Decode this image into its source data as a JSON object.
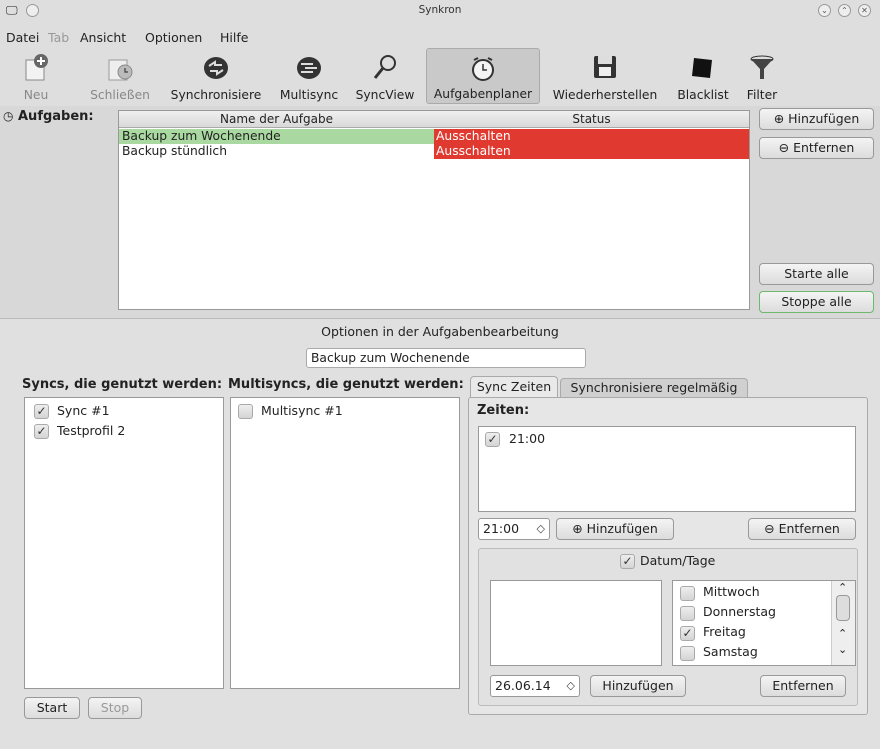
{
  "window": {
    "title": "Synkron"
  },
  "menu": [
    "Datei",
    "Tab",
    "Ansicht",
    "Optionen",
    "Hilfe"
  ],
  "toolbar": {
    "neu": "Neu",
    "schliessen": "Schließen",
    "synchronisiere": "Synchronisiere",
    "multisync": "Multisync",
    "syncview": "SyncView",
    "aufgabenplaner": "Aufgabenplaner",
    "wiederherstellen": "Wiederherstellen",
    "blacklist": "Blacklist",
    "filter": "Filter"
  },
  "tasks": {
    "label": "Aufgaben:",
    "col_name": "Name der Aufgabe",
    "col_status": "Status",
    "rows": [
      {
        "name": "Backup zum Wochenende",
        "status": "Ausschalten"
      },
      {
        "name": "Backup stündlich",
        "status": "Ausschalten"
      }
    ],
    "add": "Hinzufügen",
    "remove": "Entfernen",
    "start_all": "Starte alle",
    "stop_all": "Stoppe alle"
  },
  "options": {
    "title": "Optionen in der Aufgabenbearbeitung",
    "task_name": "Backup zum Wochenende",
    "syncs_label": "Syncs, die genutzt werden:",
    "multisyncs_label": "Multisyncs, die genutzt werden:",
    "syncs": [
      {
        "label": "Sync #1",
        "checked": true
      },
      {
        "label": "Testprofil 2",
        "checked": true
      }
    ],
    "multisyncs": [
      {
        "label": "Multisync #1",
        "checked": false
      }
    ],
    "start": "Start",
    "stop": "Stop"
  },
  "tabs": {
    "sync_zeiten": "Sync Zeiten",
    "regelmaessig": "Synchronisiere regelmäßig"
  },
  "times": {
    "label": "Zeiten:",
    "items": [
      {
        "label": "21:00",
        "checked": true
      }
    ],
    "spin_value": "21:00",
    "add": "Hinzufügen",
    "remove": "Entfernen"
  },
  "dates": {
    "group_label": "Datum/Tage",
    "group_checked": true,
    "days": [
      {
        "label": "Mittwoch",
        "checked": false
      },
      {
        "label": "Donnerstag",
        "checked": false
      },
      {
        "label": "Freitag",
        "checked": true
      },
      {
        "label": "Samstag",
        "checked": false
      }
    ],
    "date_value": "26.06.14",
    "add": "Hinzufügen",
    "remove": "Entfernen"
  },
  "colors": {
    "status_red": "#e03a30",
    "selected_row_green": "#a9d9a0",
    "window_bg": "#d8d8d8"
  }
}
